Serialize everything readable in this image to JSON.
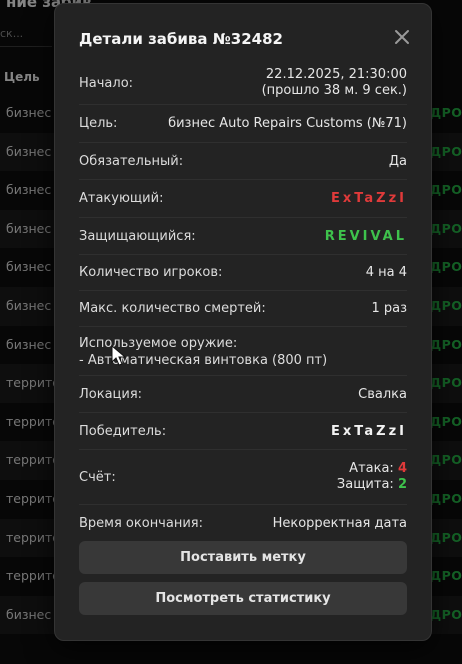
{
  "background": {
    "title": "ние забив",
    "search_placeholder": "ск...",
    "column_header": "Цель",
    "rows": [
      {
        "target": "бизнес",
        "status": "ДРОП"
      },
      {
        "target": "бизнес",
        "status": "ДРОП"
      },
      {
        "target": "бизнес",
        "status": "ДРОП"
      },
      {
        "target": "бизнес",
        "status": "ДРОП"
      },
      {
        "target": "бизнес",
        "status": "ДРОП"
      },
      {
        "target": "бизнес",
        "status": "ДРОП"
      },
      {
        "target": "бизнес",
        "status": "ДРОП"
      },
      {
        "target": "террито",
        "status": "ДРОП"
      },
      {
        "target": "террито",
        "status": "ДРОП"
      },
      {
        "target": "террито",
        "status": "ДРОП"
      },
      {
        "target": "террито",
        "status": "ДРОП"
      },
      {
        "target": "террито",
        "status": "ДРОП"
      },
      {
        "target": "террито",
        "status": "ДРОП"
      },
      {
        "target": "бизнес",
        "status": "ДРОП"
      }
    ],
    "status_color": "#25b245"
  },
  "modal": {
    "title": "Детали забива №32482",
    "close_icon": "close-icon",
    "start_label": "Начало:",
    "start_value": "22.12.2025, 21:30:00",
    "start_ago": "(прошло 38 м. 9 сек.)",
    "target_label": "Цель:",
    "target_value": "бизнес Auto Repairs Customs (№71)",
    "mandatory_label": "Обязательный:",
    "mandatory_value": "Да",
    "attacker_label": "Атакующий:",
    "attacker_value": "ExTaZzI",
    "attacker_color": "#e03a3a",
    "defender_label": "Защищающийся:",
    "defender_value": "REVIVAL",
    "defender_color": "#3ec24c",
    "players_label": "Количество игроков:",
    "players_value": "4 на 4",
    "max_deaths_label": "Макс. количество смертей:",
    "max_deaths_value": "1 раз",
    "weapons_label": "Используемое оружие:",
    "weapons_value": "- Автоматическая винтовка (800 пт)",
    "location_label": "Локация:",
    "location_value": "Свалка",
    "winner_label": "Победитель:",
    "winner_value": "ExTaZzI",
    "score_label": "Счёт:",
    "score_attack_label": "Атака:",
    "score_attack_value": "4",
    "score_defense_label": "Защита:",
    "score_defense_value": "2",
    "end_label": "Время окончания:",
    "end_value": "Некорректная дата",
    "mark_button": "Поставить метку",
    "stats_button": "Посмотреть статистику"
  }
}
